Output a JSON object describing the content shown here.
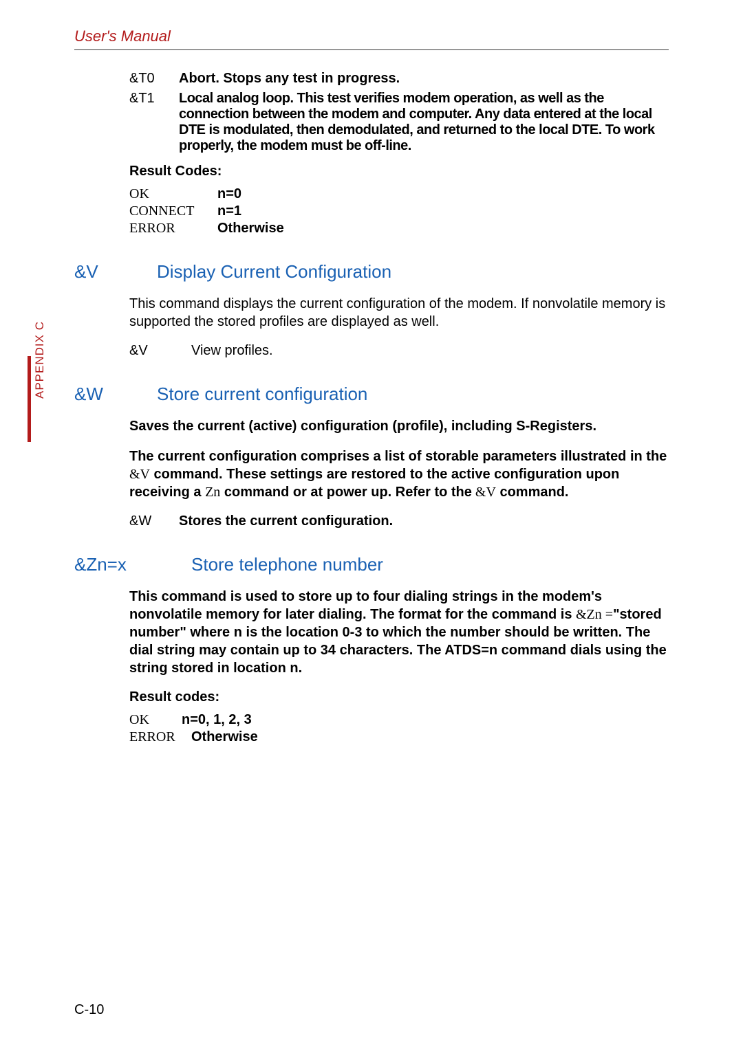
{
  "header": "User's Manual",
  "side_tab": "APPENDIX C",
  "t_rows": [
    {
      "cmd": "&T0",
      "desc": "Abort. Stops any test in progress."
    },
    {
      "cmd": "&T1",
      "desc": "Local analog loop. This test verifies modem operation, as well as the connection between the modem and computer. Any data entered at the local DTE is modulated, then demodulated, and returned to the local DTE. To work properly, the modem must be off-line."
    }
  ],
  "result_codes_caption": "Result Codes:",
  "t_result": [
    {
      "a": "OK",
      "b": "n=0"
    },
    {
      "a": "CONNECT",
      "b": "n=1"
    },
    {
      "a": "ERROR",
      "b": "Otherwise"
    }
  ],
  "sections": {
    "v": {
      "cmd": "&V",
      "title": "Display Current Configuration",
      "body": "This command displays the current configuration of the modem. If nonvolatile memory is supported the stored profiles are displayed as well.",
      "row": {
        "a": "&V",
        "b": "View profiles."
      }
    },
    "w": {
      "cmd": "&W",
      "title": "Store current configuration",
      "body1": "Saves the current (active) configuration (profile), including S-Regis­ters.",
      "body2_pre": "The current configuration comprises a list of storable parameters illustrated in the",
      "body2_c1": " &V",
      "body2_mid": " command. These settings are restored to the active configuration upon receiving a",
      "body2_c2": "Zn",
      "body2_post": " command or at power up. Refer to the",
      "body2_c3": " &V",
      "body2_end": " command.",
      "row": {
        "a": "&W",
        "b": "Stores the current configuration."
      }
    },
    "z": {
      "cmd": "&Zn=x",
      "title": "Store  telephone number",
      "body_pre": "This command is used to store up to four dialing strings in the modem's nonvolatile memory for later dialing. The format for the command is",
      "body_c1": "&Zn =",
      "body_post": "\"stored number\" where n is the location 0-3 to which the number should be written. The dial string may contain up to 34 characters. The ATDS=n command dials using the string stored in location n.",
      "result_caption": "Result codes:",
      "result": [
        {
          "a": "OK",
          "b": "n=0, 1, 2, 3"
        },
        {
          "a": "ERROR",
          "b": "Otherwise"
        }
      ]
    }
  },
  "footer": "C-10"
}
